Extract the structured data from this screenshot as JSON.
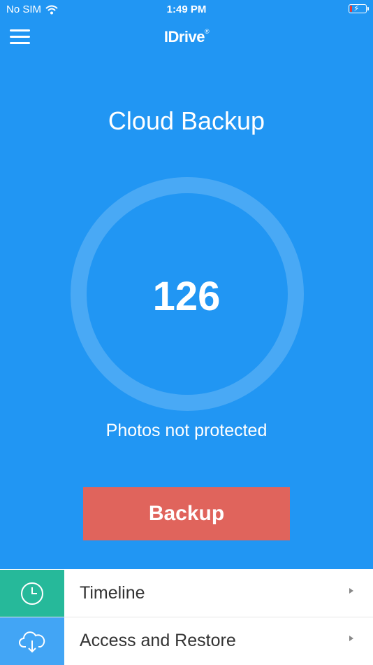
{
  "status_bar": {
    "carrier": "No SIM",
    "time": "1:49 PM",
    "battery_level": 0.15
  },
  "header": {
    "logo": "IDrive",
    "logo_mark": "®"
  },
  "main": {
    "title": "Cloud Backup",
    "count": "126",
    "subtitle": "Photos not protected",
    "backup_label": "Backup"
  },
  "menu": {
    "items": [
      {
        "label": "Timeline",
        "icon": "clock-icon"
      },
      {
        "label": "Access and Restore",
        "icon": "cloud-download-icon"
      }
    ]
  },
  "colors": {
    "background": "#2196F3",
    "backup_button": "#E0645C",
    "timeline_icon_bg": "#26B99A",
    "restore_icon_bg": "#42A5F5"
  }
}
